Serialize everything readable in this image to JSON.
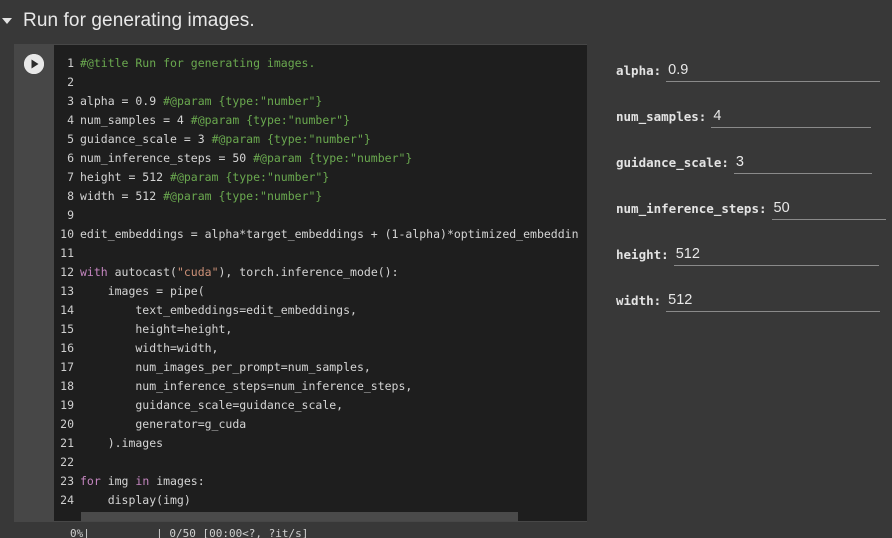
{
  "section": {
    "title": "Run for generating images."
  },
  "editor": {
    "lines": [
      {
        "n": "1",
        "parts": [
          {
            "t": "#@title Run for generating images.",
            "c": "c-comment"
          }
        ]
      },
      {
        "n": "2",
        "parts": []
      },
      {
        "n": "3",
        "parts": [
          {
            "t": "alpha = 0.9 ",
            "c": ""
          },
          {
            "t": "#@param {type:\"number\"}",
            "c": "c-comment"
          }
        ]
      },
      {
        "n": "4",
        "parts": [
          {
            "t": "num_samples = 4 ",
            "c": ""
          },
          {
            "t": "#@param {type:\"number\"}",
            "c": "c-comment"
          }
        ]
      },
      {
        "n": "5",
        "parts": [
          {
            "t": "guidance_scale = 3 ",
            "c": ""
          },
          {
            "t": "#@param {type:\"number\"}",
            "c": "c-comment"
          }
        ]
      },
      {
        "n": "6",
        "parts": [
          {
            "t": "num_inference_steps = 50 ",
            "c": ""
          },
          {
            "t": "#@param {type:\"number\"}",
            "c": "c-comment"
          }
        ]
      },
      {
        "n": "7",
        "parts": [
          {
            "t": "height = 512 ",
            "c": ""
          },
          {
            "t": "#@param {type:\"number\"}",
            "c": "c-comment"
          }
        ]
      },
      {
        "n": "8",
        "parts": [
          {
            "t": "width = 512 ",
            "c": ""
          },
          {
            "t": "#@param {type:\"number\"}",
            "c": "c-comment"
          }
        ]
      },
      {
        "n": "9",
        "parts": []
      },
      {
        "n": "10",
        "parts": [
          {
            "t": "edit_embeddings = alpha*target_embeddings + (1-alpha)*optimized_embeddin",
            "c": ""
          }
        ]
      },
      {
        "n": "11",
        "parts": []
      },
      {
        "n": "12",
        "parts": [
          {
            "t": "with",
            "c": "c-kw"
          },
          {
            "t": " autocast(",
            "c": ""
          },
          {
            "t": "\"cuda\"",
            "c": "c-str"
          },
          {
            "t": "), torch.inference_mode():",
            "c": ""
          }
        ]
      },
      {
        "n": "13",
        "parts": [
          {
            "t": "    images = pipe(",
            "c": ""
          }
        ]
      },
      {
        "n": "14",
        "parts": [
          {
            "t": "        text_embeddings=edit_embeddings,",
            "c": ""
          }
        ]
      },
      {
        "n": "15",
        "parts": [
          {
            "t": "        height=height,",
            "c": ""
          }
        ]
      },
      {
        "n": "16",
        "parts": [
          {
            "t": "        width=width,",
            "c": ""
          }
        ]
      },
      {
        "n": "17",
        "parts": [
          {
            "t": "        num_images_per_prompt=num_samples,",
            "c": ""
          }
        ]
      },
      {
        "n": "18",
        "parts": [
          {
            "t": "        num_inference_steps=num_inference_steps,",
            "c": ""
          }
        ]
      },
      {
        "n": "19",
        "parts": [
          {
            "t": "        guidance_scale=guidance_scale,",
            "c": ""
          }
        ]
      },
      {
        "n": "20",
        "parts": [
          {
            "t": "        generator=g_cuda",
            "c": ""
          }
        ]
      },
      {
        "n": "21",
        "parts": [
          {
            "t": "    ).images",
            "c": ""
          }
        ]
      },
      {
        "n": "22",
        "parts": []
      },
      {
        "n": "23",
        "parts": [
          {
            "t": "for",
            "c": "c-kw"
          },
          {
            "t": " img ",
            "c": ""
          },
          {
            "t": "in",
            "c": "c-kw"
          },
          {
            "t": " images:",
            "c": ""
          }
        ]
      },
      {
        "n": "24",
        "parts": [
          {
            "t": "    display(img)",
            "c": ""
          }
        ]
      }
    ]
  },
  "output": {
    "text": "0%|          | 0/50 [00:00<?, ?it/s]"
  },
  "form": {
    "fields": [
      {
        "key": "alpha",
        "label": "alpha:",
        "value": "0.9"
      },
      {
        "key": "num_samples",
        "label": "num_samples:",
        "value": "4"
      },
      {
        "key": "guidance_scale",
        "label": "guidance_scale:",
        "value": "3"
      },
      {
        "key": "num_inference_steps",
        "label": "num_inference_steps:",
        "value": "50"
      },
      {
        "key": "height",
        "label": "height:",
        "value": "512"
      },
      {
        "key": "width",
        "label": "width:",
        "value": "512"
      }
    ]
  },
  "icons": {
    "run": "play-icon",
    "collapse": "caret-down-icon"
  },
  "colors": {
    "background": "#383838",
    "editor": "#1e1e1e",
    "comment": "#6aa84f",
    "keyword": "#c586c0",
    "string": "#ce9178"
  }
}
